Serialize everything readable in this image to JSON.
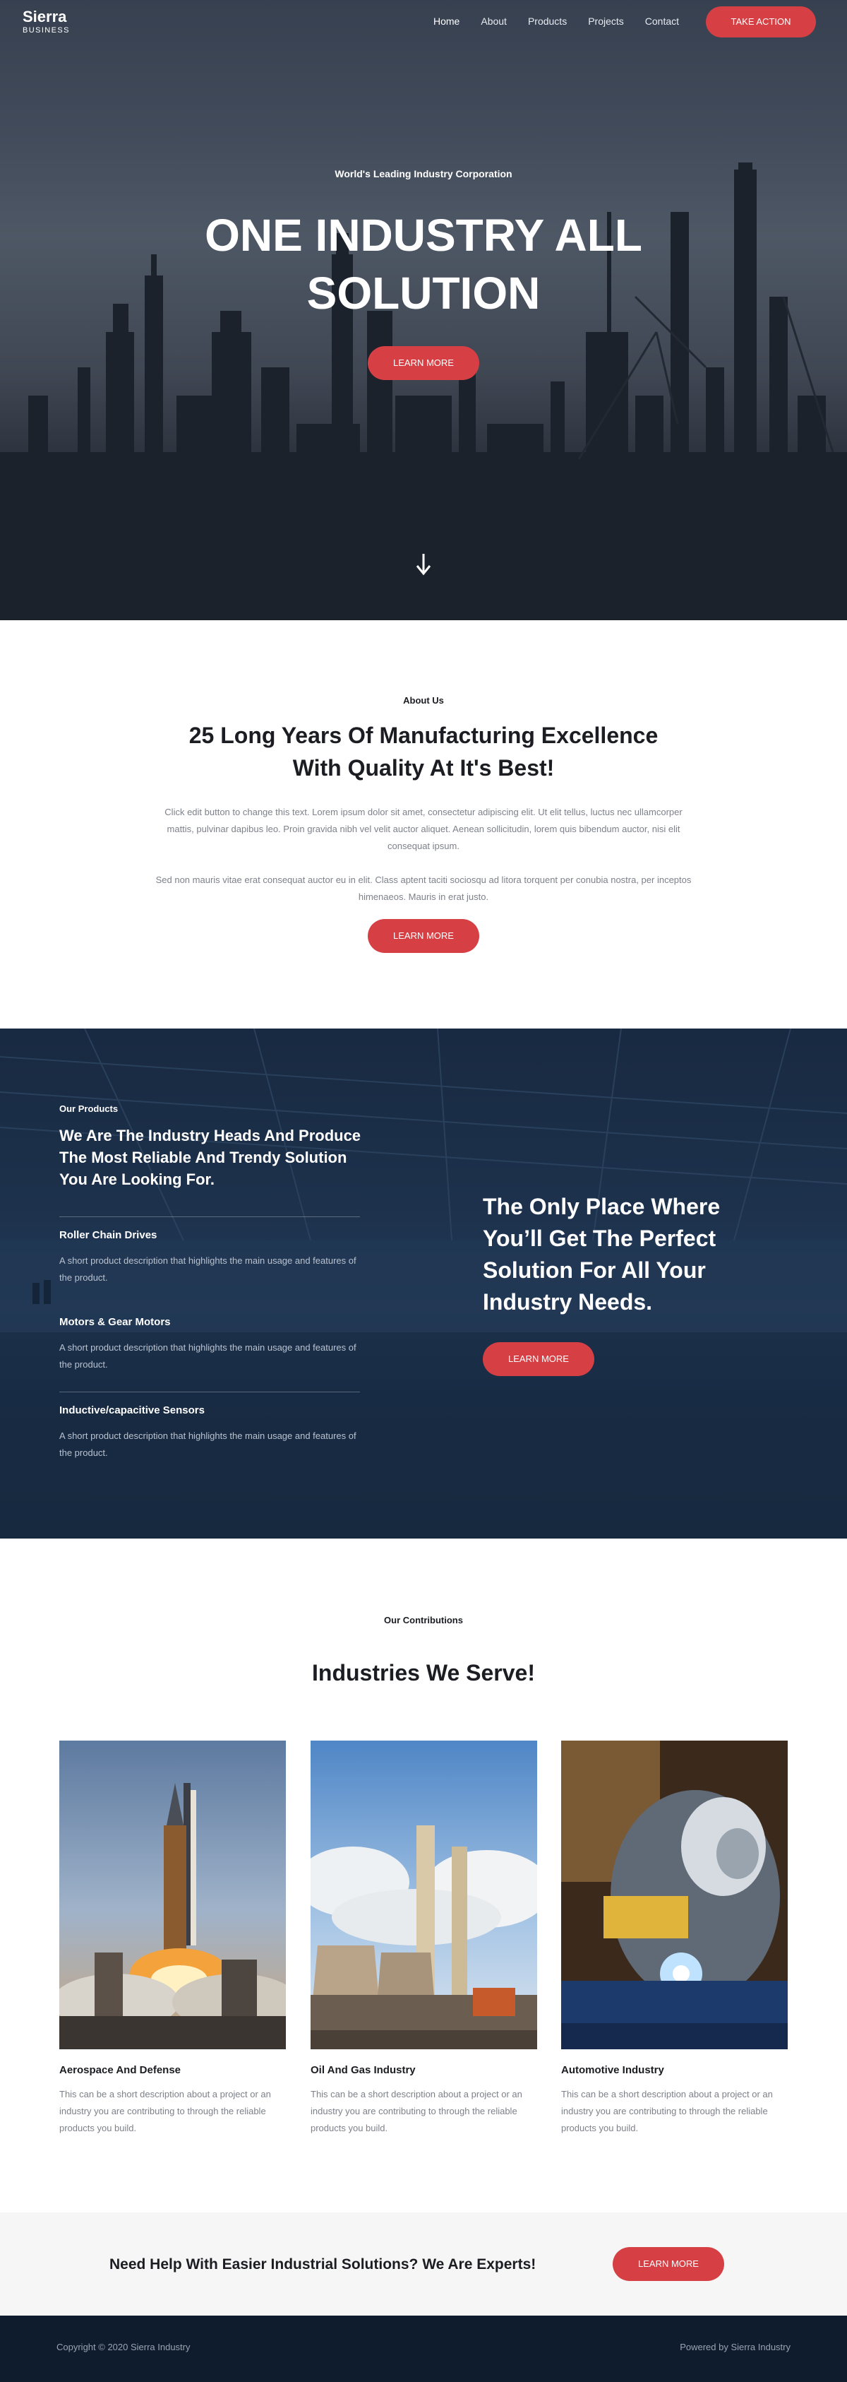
{
  "colors": {
    "accent": "#d64044",
    "footer_bg": "#0f1c2e",
    "cta_strip_bg": "#f6f6f7",
    "text_dark": "#1b1d22",
    "text_muted": "#7d818a"
  },
  "nav": {
    "logo_name": "Sierra",
    "logo_sub": "BUSINESS",
    "links": [
      "Home",
      "About",
      "Products",
      "Projects",
      "Contact"
    ],
    "cta": "TAKE ACTION"
  },
  "hero": {
    "eyebrow": "World's Leading Industry Corporation",
    "title": "ONE INDUSTRY ALL SOLUTION",
    "cta": "LEARN MORE",
    "scroll_icon": "arrow-down-icon"
  },
  "about": {
    "eyebrow": "About Us",
    "title": "25 Long Years Of Manufacturing Excellence With Quality At It's Best!",
    "paragraph1": "Click edit button to change this text. Lorem ipsum dolor sit amet, consectetur adipiscing elit. Ut elit tellus, luctus nec ullamcorper mattis, pulvinar dapibus leo. Proin gravida nibh vel velit auctor aliquet. Aenean sollicitudin, lorem quis bibendum auctor, nisi elit consequat ipsum.",
    "paragraph2": "Sed non mauris vitae erat consequat auctor eu in elit. Class aptent taciti sociosqu ad litora torquent per conubia nostra, per inceptos himenaeos. Mauris in erat justo.",
    "cta": "LEARN MORE"
  },
  "products": {
    "eyebrow": "Our Products",
    "heading": "We Are The Industry Heads And Produce The Most Reliable And Trendy Solution You Are Looking For.",
    "items": [
      {
        "title": "Roller Chain Drives",
        "desc": "A short product description that highlights the main usage and features of the product."
      },
      {
        "title": "Motors & Gear Motors",
        "desc": "A short product description that highlights the main usage and features of the product."
      },
      {
        "title": "Inductive/capacitive Sensors",
        "desc": "A short product description that highlights the main usage and features of the product."
      }
    ],
    "right_title": "The Only Place Where You’ll Get The Perfect Solution For All Your Industry Needs.",
    "cta": "LEARN MORE"
  },
  "industries": {
    "eyebrow": "Our Contributions",
    "title": "Industries We Serve!",
    "cards": [
      {
        "title": "Aerospace And Defense",
        "desc": "This can be a short description about a project or an industry you are contributing to through the reliable products you build."
      },
      {
        "title": "Oil And Gas Industry",
        "desc": "This can be a short description about a project or an industry you are contributing to through the reliable products you build."
      },
      {
        "title": "Automotive Industry",
        "desc": "This can be a short description about a project or an industry you are contributing to through the reliable products you build."
      }
    ]
  },
  "cta_strip": {
    "text": "Need Help With Easier Industrial Solutions? We Are Experts!",
    "cta": "LEARN MORE"
  },
  "footer": {
    "copyright": "Copyright © 2020 Sierra Industry",
    "powered": "Powered by Sierra Industry"
  }
}
